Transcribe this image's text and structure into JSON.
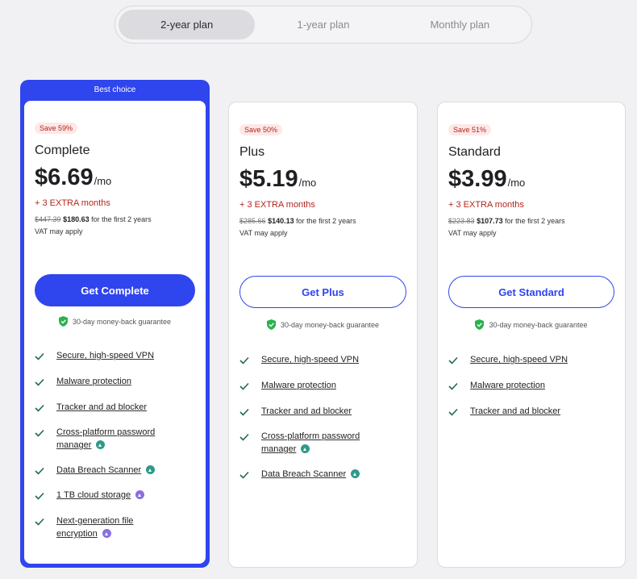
{
  "tabs": [
    {
      "label": "2-year plan",
      "active": true
    },
    {
      "label": "1-year plan",
      "active": false
    },
    {
      "label": "Monthly plan",
      "active": false
    }
  ],
  "guarantee": "30-day money-back guarantee",
  "plans": [
    {
      "banner": "Best choice",
      "save": "Save 59%",
      "name": "Complete",
      "price": "$6.69",
      "per": "/mo",
      "extra": "+ 3 EXTRA months",
      "old_total": "$447.39",
      "new_total": "$180.63",
      "period": " for the first 2 years",
      "vat": "VAT may apply",
      "button": "Get Complete",
      "features": [
        {
          "label": "Secure, high-speed VPN",
          "badge": null
        },
        {
          "label": "Malware protection",
          "badge": null
        },
        {
          "label": "Tracker and ad blocker",
          "badge": null
        },
        {
          "label": "Cross-platform password manager",
          "badge": "teal"
        },
        {
          "label": "Data Breach Scanner",
          "badge": "teal"
        },
        {
          "label": "1 TB cloud storage",
          "badge": "purple"
        },
        {
          "label": "Next-generation file encryption",
          "badge": "purple"
        }
      ]
    },
    {
      "save": "Save 50%",
      "name": "Plus",
      "price": "$5.19",
      "per": "/mo",
      "extra": "+ 3 EXTRA months",
      "old_total": "$285.66",
      "new_total": "$140.13",
      "period": " for the first 2 years",
      "vat": "VAT may apply",
      "button": "Get Plus",
      "features": [
        {
          "label": "Secure, high-speed VPN",
          "badge": null
        },
        {
          "label": "Malware protection",
          "badge": null
        },
        {
          "label": "Tracker and ad blocker",
          "badge": null
        },
        {
          "label": "Cross-platform password manager",
          "badge": "teal"
        },
        {
          "label": "Data Breach Scanner",
          "badge": "teal"
        }
      ]
    },
    {
      "save": "Save 51%",
      "name": "Standard",
      "price": "$3.99",
      "per": "/mo",
      "extra": "+ 3 EXTRA months",
      "old_total": "$223.83",
      "new_total": "$107.73",
      "period": " for the first 2 years",
      "vat": "VAT may apply",
      "button": "Get Standard",
      "features": [
        {
          "label": "Secure, high-speed VPN",
          "badge": null
        },
        {
          "label": "Malware protection",
          "badge": null
        },
        {
          "label": "Tracker and ad blocker",
          "badge": null
        }
      ]
    }
  ],
  "colors": {
    "accent": "#2f45ee",
    "sale": "#b3261e",
    "check": "#1e6b54",
    "shield": "#2bb24c"
  }
}
